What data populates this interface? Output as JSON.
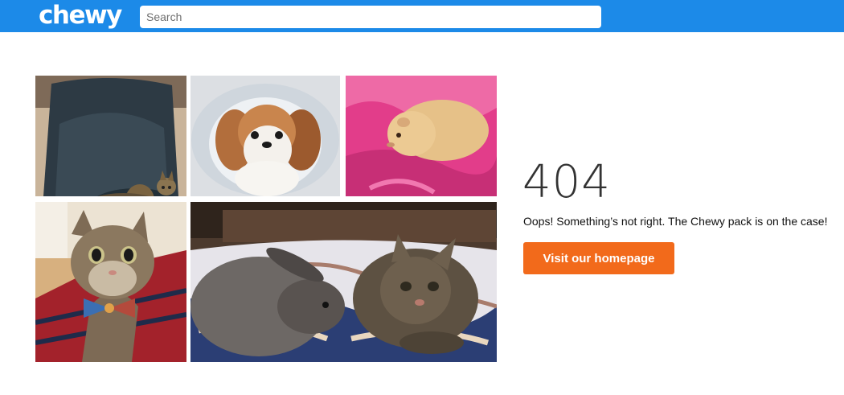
{
  "header": {
    "logo_text": "chewy",
    "search_placeholder": "Search"
  },
  "error": {
    "code": "404",
    "message": "Oops! Something’s not right. The Chewy pack is on the case!",
    "cta_label": "Visit our homepage"
  },
  "photos": [
    {
      "subject": "tabby kitten on dark chair"
    },
    {
      "subject": "shih tzu dog in bed"
    },
    {
      "subject": "guinea pig on pink blanket"
    },
    {
      "subject": "tabby cat wearing bow tie"
    },
    {
      "subject": "rabbit and tabby cat on bed"
    }
  ],
  "colors": {
    "header": "#1c8ae8",
    "cta": "#f26a1b"
  }
}
